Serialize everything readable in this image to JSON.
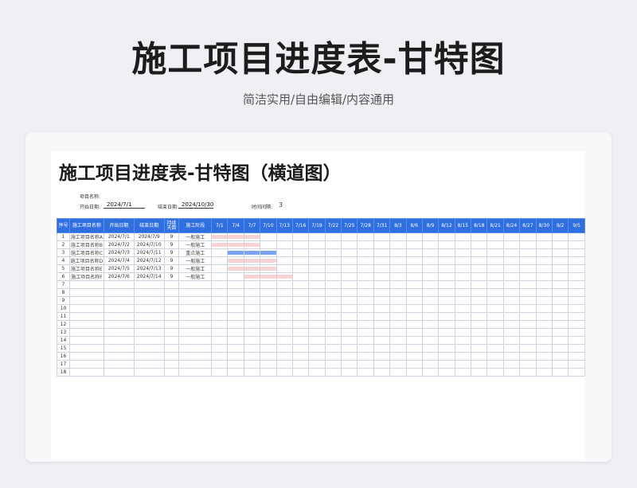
{
  "header": {
    "title": "施工项目进度表-甘特图",
    "subtitle": "简洁实用/自由编辑/内容通用"
  },
  "sheet": {
    "title": "施工项目进度表-甘特图（横道图）",
    "project_name_label": "项目名称:",
    "start_date_label": "开始日期:",
    "start_date_value": "2024/7/1",
    "end_date_label": "结束日期:",
    "end_date_value": "2024/10/30",
    "interval_label": "时间间隔:",
    "interval_value": "3"
  },
  "table": {
    "columns": [
      "序号",
      "施工项目名称",
      "开始日期",
      "结束日期",
      "持续天数",
      "施工阶段"
    ],
    "timeline": [
      "7/1",
      "7/4",
      "7/7",
      "7/10",
      "7/13",
      "7/16",
      "7/19",
      "7/22",
      "7/25",
      "7/28",
      "7/31",
      "8/3",
      "8/6",
      "8/9",
      "8/12",
      "8/15",
      "8/18",
      "8/21",
      "8/24",
      "8/27",
      "8/30",
      "9/2",
      "9/5"
    ],
    "rows": [
      {
        "idx": "1",
        "name": "施工项目名称A",
        "start": "2024/7/1",
        "end": "2024/7/9",
        "days": "9",
        "stage": "一般施工"
      },
      {
        "idx": "2",
        "name": "施工项目名称B",
        "start": "2024/7/2",
        "end": "2024/7/10",
        "days": "9",
        "stage": "一般施工"
      },
      {
        "idx": "3",
        "name": "施工项目名称C",
        "start": "2024/7/3",
        "end": "2024/7/11",
        "days": "9",
        "stage": "重点施工"
      },
      {
        "idx": "4",
        "name": "施工项目名称D",
        "start": "2024/7/4",
        "end": "2024/7/12",
        "days": "9",
        "stage": "一般施工"
      },
      {
        "idx": "5",
        "name": "施工项目名称E",
        "start": "2024/7/5",
        "end": "2024/7/13",
        "days": "9",
        "stage": "一般施工"
      },
      {
        "idx": "6",
        "name": "施工项目名称F",
        "start": "2024/7/6",
        "end": "2024/7/14",
        "days": "9",
        "stage": "一般施工"
      },
      {
        "idx": "7"
      },
      {
        "idx": "8"
      },
      {
        "idx": "9"
      },
      {
        "idx": "10"
      },
      {
        "idx": "11"
      },
      {
        "idx": "12"
      },
      {
        "idx": "13"
      },
      {
        "idx": "14"
      },
      {
        "idx": "15"
      },
      {
        "idx": "16"
      },
      {
        "idx": "17"
      },
      {
        "idx": "18"
      }
    ]
  },
  "colors": {
    "header_bg": "#2f6fe0",
    "bar_normal": "#f8d3d3",
    "bar_key": "#7aa4f0"
  }
}
